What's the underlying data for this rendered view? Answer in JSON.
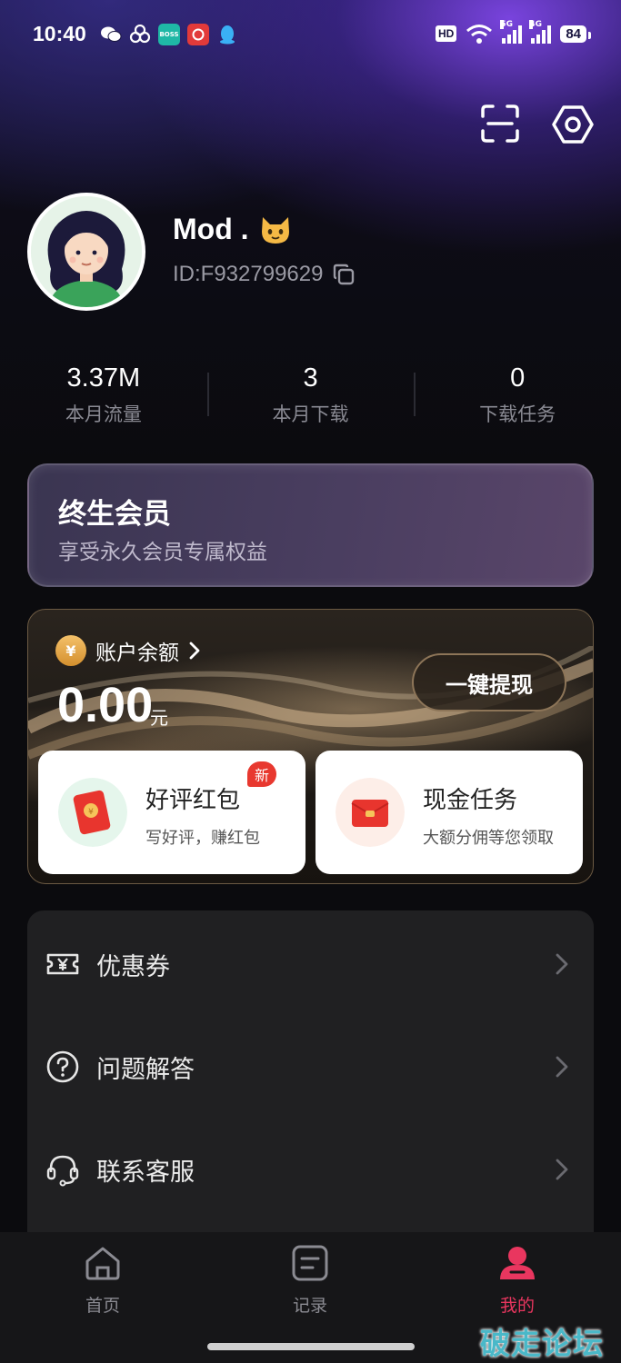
{
  "status_bar": {
    "time": "10:40",
    "hd_badge": "HD",
    "net_1": "5G",
    "net_2": "4G",
    "battery": "84"
  },
  "profile": {
    "nickname": "Mod .",
    "user_id": "ID:F932799629"
  },
  "stats": [
    {
      "value": "3.37M",
      "label": "本月流量"
    },
    {
      "value": "3",
      "label": "本月下载"
    },
    {
      "value": "0",
      "label": "下载任务"
    }
  ],
  "member": {
    "title": "终生会员",
    "subtitle": "享受永久会员专属权益"
  },
  "balance": {
    "label": "账户余额",
    "amount": "0.00",
    "unit": "元",
    "withdraw_label": "一键提现",
    "coin_symbol": "¥"
  },
  "task_cards": [
    {
      "title": "好评红包",
      "subtitle": "写好评，赚红包",
      "badge": "新"
    },
    {
      "title": "现金任务",
      "subtitle": "大额分佣等您领取"
    }
  ],
  "menu": [
    {
      "label": "优惠券",
      "icon": "coupon-icon"
    },
    {
      "label": "问题解答",
      "icon": "help-icon"
    },
    {
      "label": "联系客服",
      "icon": "headset-icon"
    }
  ],
  "tabs": [
    {
      "label": "首页",
      "icon": "home-icon"
    },
    {
      "label": "记录",
      "icon": "record-icon"
    },
    {
      "label": "我的",
      "icon": "profile-icon",
      "active": true
    }
  ],
  "watermark": "破走论坛",
  "colors": {
    "accent": "#e9365f",
    "background": "#0b0b0e",
    "card_gold_border": "#6c5a43",
    "badge_red": "#e8382f"
  }
}
